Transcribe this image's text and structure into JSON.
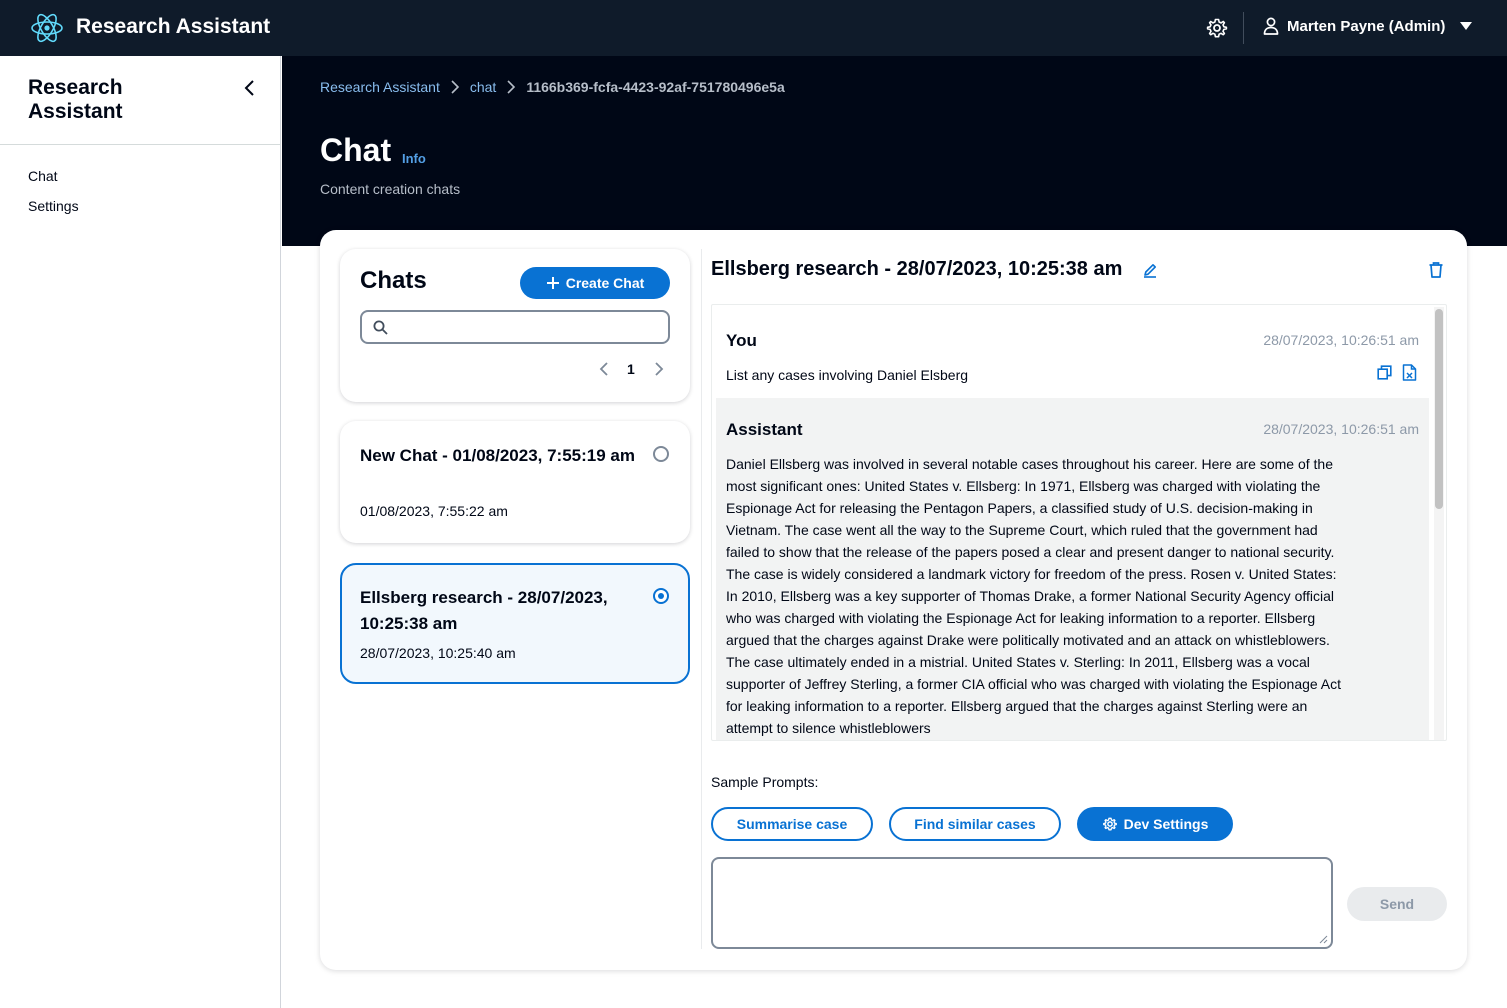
{
  "app": {
    "title": "Research Assistant",
    "user": "Marten Payne (Admin)"
  },
  "sidebar": {
    "title": "Research Assistant",
    "items": [
      {
        "label": "Chat"
      },
      {
        "label": "Settings"
      }
    ]
  },
  "breadcrumbs": [
    {
      "label": "Research Assistant"
    },
    {
      "label": "chat"
    },
    {
      "label": "1166b369-fcfa-4423-92af-751780496e5a"
    }
  ],
  "page": {
    "title": "Chat",
    "info_label": "Info",
    "description": "Content creation chats"
  },
  "chats": {
    "heading": "Chats",
    "create_label": "Create Chat",
    "search_value": "",
    "page_number": "1",
    "items": [
      {
        "title": "New Chat - 01/08/2023, 7:55:19 am",
        "date": "01/08/2023, 7:55:22 am",
        "selected": false
      },
      {
        "title": "Ellsberg research - 28/07/2023, 10:25:38 am",
        "date": "28/07/2023, 10:25:40 am",
        "selected": true
      }
    ]
  },
  "conversation": {
    "title": "Ellsberg research - 28/07/2023, 10:25:38 am",
    "messages": [
      {
        "author": "You",
        "time": "28/07/2023, 10:26:51 am",
        "text": "List any cases involving Daniel Elsberg"
      },
      {
        "author": "Assistant",
        "time": "28/07/2023, 10:26:51 am",
        "text": "Daniel Ellsberg was involved in several notable cases throughout his career. Here are some of the most significant ones: United States v. Ellsberg: In 1971, Ellsberg was charged with violating the Espionage Act for releasing the Pentagon Papers, a classified study of U.S. decision-making in Vietnam. The case went all the way to the Supreme Court, which ruled that the government had failed to show that the release of the papers posed a clear and present danger to national security. The case is widely considered a landmark victory for freedom of the press. Rosen v. United States: In 2010, Ellsberg was a key supporter of Thomas Drake, a former National Security Agency official who was charged with violating the Espionage Act for leaking information to a reporter. Ellsberg argued that the charges against Drake were politically motivated and an attack on whistleblowers. The case ultimately ended in a mistrial. United States v. Sterling: In 2011, Ellsberg was a vocal supporter of Jeffrey Sterling, a former CIA official who was charged with violating the Espionage Act for leaking information to a reporter. Ellsberg argued that the charges against Sterling were an attempt to silence whistleblowers"
      }
    ],
    "sample_prompts_label": "Sample Prompts:",
    "sample_prompts": [
      {
        "label": "Summarise case"
      },
      {
        "label": "Find similar cases"
      }
    ],
    "dev_settings_label": "Dev Settings",
    "prompt_value": "",
    "send_label": "Send"
  },
  "colors": {
    "nav_bg": "#0f1b2a",
    "header_bg": "#000716",
    "accent": "#0972d3",
    "link": "#89bdee"
  }
}
